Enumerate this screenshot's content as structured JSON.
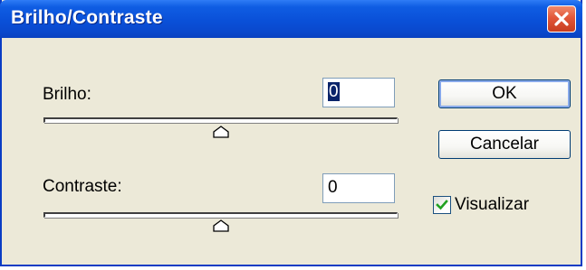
{
  "window": {
    "title": "Brilho/Contraste"
  },
  "brightness": {
    "label": "Brilho:",
    "value": "0",
    "slider_level": 0.5
  },
  "contrast": {
    "label": "Contraste:",
    "value": "0",
    "slider_level": 0.5
  },
  "buttons": {
    "ok_label": "OK",
    "cancel_label": "Cancelar"
  },
  "preview": {
    "label": "Visualizar",
    "checked": true
  },
  "icons": {
    "close": "close-icon",
    "checkmark": "checkmark-icon",
    "slider_thumb": "slider-thumb"
  },
  "colors": {
    "titlebar": "#0a50d8",
    "dialog_background": "#ece9d8",
    "close_button": "#e2573a",
    "selection": "#0a246a",
    "checkmark": "#21a121"
  }
}
